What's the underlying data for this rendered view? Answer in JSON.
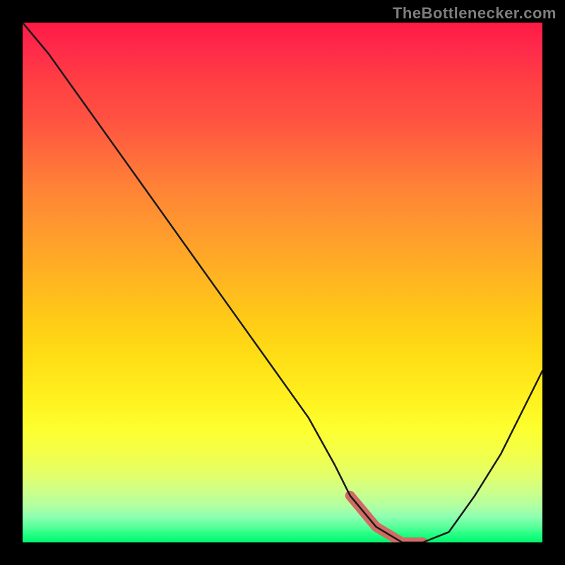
{
  "attribution": "TheBottlenecker.com",
  "chart_data": {
    "type": "line",
    "title": "",
    "xlabel": "",
    "ylabel": "",
    "xlim": [
      0,
      100
    ],
    "ylim": [
      0,
      100
    ],
    "series": [
      {
        "name": "bottleneck-curve",
        "x": [
          0,
          5,
          10,
          15,
          20,
          25,
          30,
          35,
          40,
          45,
          50,
          55,
          60,
          63,
          68,
          73,
          77,
          82,
          87,
          92,
          96,
          100
        ],
        "values": [
          100,
          94,
          87,
          80,
          73,
          66,
          59,
          52,
          45,
          38,
          31,
          24,
          15,
          9,
          3,
          0,
          0,
          2,
          9,
          17,
          25,
          33
        ]
      }
    ],
    "highlight": {
      "x": [
        63,
        68,
        73,
        77
      ],
      "values": [
        9,
        3,
        0,
        0
      ]
    },
    "background": {
      "top_color": "#ff1a44",
      "mid_color": "#ffdd15",
      "bottom_color": "#00f56e"
    }
  }
}
